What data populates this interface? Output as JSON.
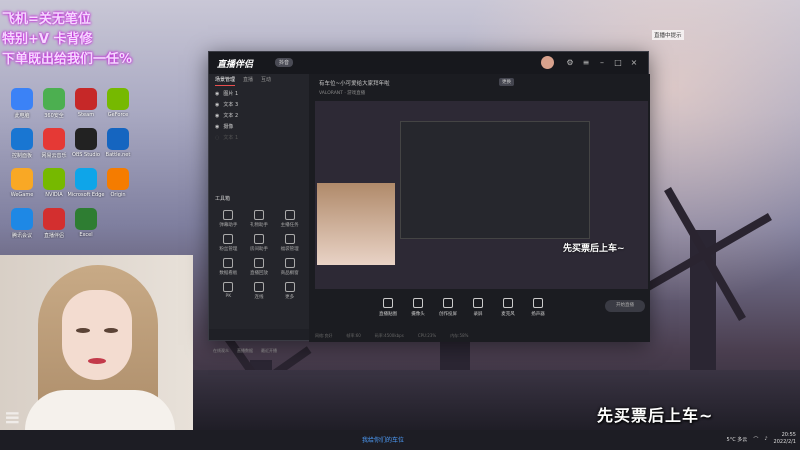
{
  "overlay": {
    "line1": "飞机=关无笔位",
    "line2": "特别+V 卡背修",
    "line3": "下单既出给我们一任%"
  },
  "desktop_icons": [
    {
      "label": "此电脑",
      "color": "#3b82f6"
    },
    {
      "label": "360安全",
      "color": "#4caf50"
    },
    {
      "label": "Steam",
      "color": "#c62828"
    },
    {
      "label": "GeForce",
      "color": "#76b900"
    },
    {
      "label": "控制面板",
      "color": "#1976d2"
    },
    {
      "label": "网易云音乐",
      "color": "#e53935"
    },
    {
      "label": "OBS Studio",
      "color": "#222"
    },
    {
      "label": "Battle.net",
      "color": "#1565c0"
    },
    {
      "label": "WeGame",
      "color": "#f9a825"
    },
    {
      "label": "NVIDIA",
      "color": "#76b900"
    },
    {
      "label": "Microsoft Edge",
      "color": "#0ea5e9"
    },
    {
      "label": "Origin",
      "color": "#f57c00"
    },
    {
      "label": "腾讯会议",
      "color": "#1e88e5"
    },
    {
      "label": "直播伴侣",
      "color": "#d32f2f"
    },
    {
      "label": "Excel",
      "color": "#2e7d32"
    }
  ],
  "app": {
    "title": "直播伴侣",
    "badge": "抖音",
    "left_tabs": [
      "场景管理",
      "直播",
      "互动"
    ],
    "scenes": [
      "图片 1",
      "文本 3",
      "文本 2",
      "摄像",
      "文本 1"
    ],
    "tools_title": "工具箱",
    "tools": [
      "弹幕助手",
      "礼物助手",
      "主播任务",
      "粉丝管理",
      "房间助手",
      "福袋管理",
      "数据看板",
      "直播回放",
      "商品橱窗",
      "PK",
      "连线",
      "更多"
    ],
    "room_title": "有车位~小可爱给大家拜年啦",
    "room_tag": "更换",
    "room_sub": "VALORANT · 游戏直播",
    "caption_small": "先买票后上车~",
    "toolbar": [
      "直播贴图",
      "摄像头",
      "创作投屏",
      "录屏",
      "麦克风",
      "扬声器"
    ],
    "start_button": "开始直播",
    "status": [
      "网络:良好",
      "帧率:60",
      "码率:4500kbps",
      "CPU:23%",
      "内存:58%"
    ],
    "left_status": [
      "在线观众",
      "直播数据",
      "最近开播"
    ]
  },
  "caption_big": "先买票后上车~",
  "top_right_tag": "直播中提示",
  "taskbar": {
    "center_text": "我给你们的车位",
    "weather": "5°C 多云",
    "time": "20:55",
    "date": "2022/2/1"
  }
}
